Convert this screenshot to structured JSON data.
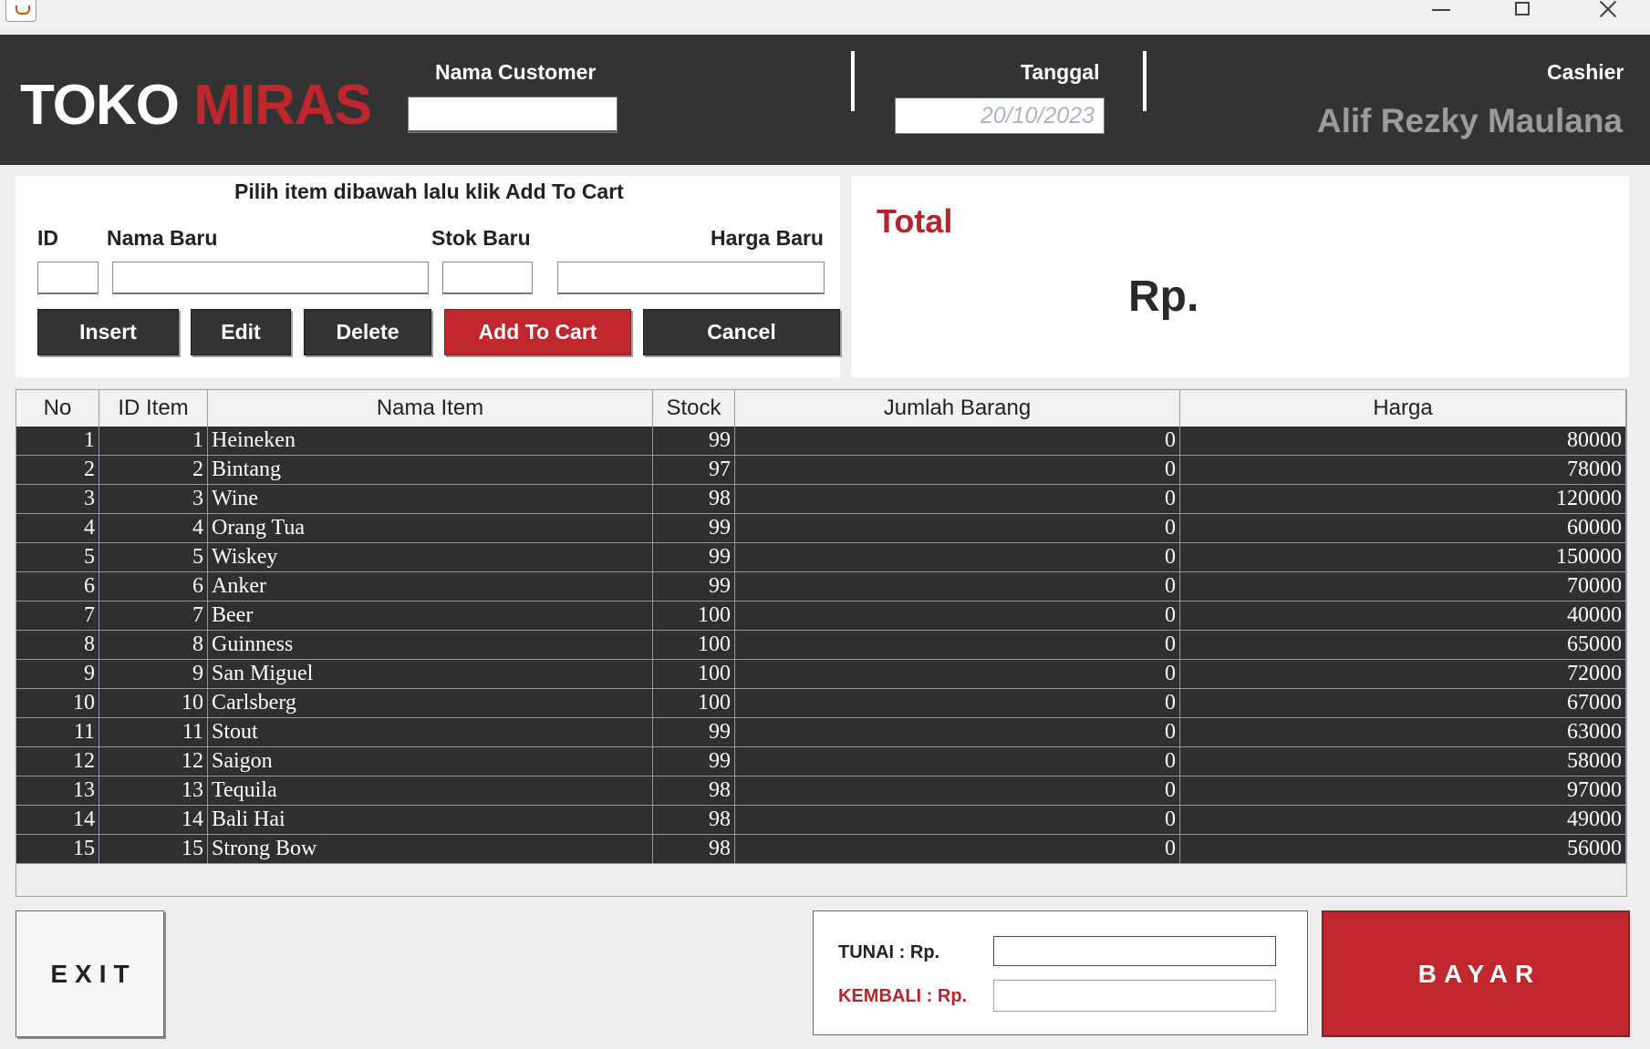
{
  "window": {
    "minimize_icon": "minimize-icon",
    "maximize_icon": "maximize-icon",
    "close_icon": "close-icon",
    "app_icon": "java-icon"
  },
  "header": {
    "logo_part1": "TOKO",
    "logo_part2": "MIRAS",
    "customer_label": "Nama Customer",
    "customer_value": "",
    "tanggal_label": "Tanggal",
    "tanggal_value": "20/10/2023",
    "cashier_label": "Cashier",
    "cashier_name": "Alif Rezky Maulana",
    "colors": {
      "background": "#333333",
      "accent": "#c0272d",
      "cashier_text": "#9b9b9b"
    }
  },
  "form": {
    "title": "Pilih item dibawah lalu klik Add To Cart",
    "id_label": "ID",
    "nama_label": "Nama Baru",
    "stok_label": "Stok Baru",
    "harga_label": "Harga Baru",
    "id_value": "",
    "nama_value": "",
    "stok_value": "",
    "harga_value": "",
    "buttons": {
      "insert": "Insert",
      "edit": "Edit",
      "delete": "Delete",
      "add_to_cart": "Add To Cart",
      "cancel": "Cancel"
    }
  },
  "total": {
    "label": "Total",
    "value": "Rp."
  },
  "table": {
    "columns": [
      "No",
      "ID Item",
      "Nama Item",
      "Stock",
      "Jumlah Barang",
      "Harga"
    ],
    "rows": [
      [
        "1",
        "1",
        "Heineken",
        "99",
        "0",
        "80000"
      ],
      [
        "2",
        "2",
        "Bintang",
        "97",
        "0",
        "78000"
      ],
      [
        "3",
        "3",
        "Wine",
        "98",
        "0",
        "120000"
      ],
      [
        "4",
        "4",
        "Orang Tua",
        "99",
        "0",
        "60000"
      ],
      [
        "5",
        "5",
        "Wiskey",
        "99",
        "0",
        "150000"
      ],
      [
        "6",
        "6",
        "Anker",
        "99",
        "0",
        "70000"
      ],
      [
        "7",
        "7",
        "Beer",
        "100",
        "0",
        "40000"
      ],
      [
        "8",
        "8",
        "Guinness",
        "100",
        "0",
        "65000"
      ],
      [
        "9",
        "9",
        "San Miguel",
        "100",
        "0",
        "72000"
      ],
      [
        "10",
        "10",
        "Carlsberg",
        "100",
        "0",
        "67000"
      ],
      [
        "11",
        "11",
        "Stout",
        "99",
        "0",
        "63000"
      ],
      [
        "12",
        "12",
        "Saigon",
        "99",
        "0",
        "58000"
      ],
      [
        "13",
        "13",
        "Tequila",
        "98",
        "0",
        "97000"
      ],
      [
        "14",
        "14",
        "Bali Hai",
        "98",
        "0",
        "49000"
      ],
      [
        "15",
        "15",
        "Strong Bow",
        "98",
        "0",
        "56000"
      ]
    ]
  },
  "bottom": {
    "exit_label": "EXIT",
    "tunai_label": "TUNAI : Rp.",
    "kembali_label": "KEMBALI : Rp.",
    "tunai_value": "",
    "kembali_value": "",
    "bayar_label": "BAYAR"
  }
}
